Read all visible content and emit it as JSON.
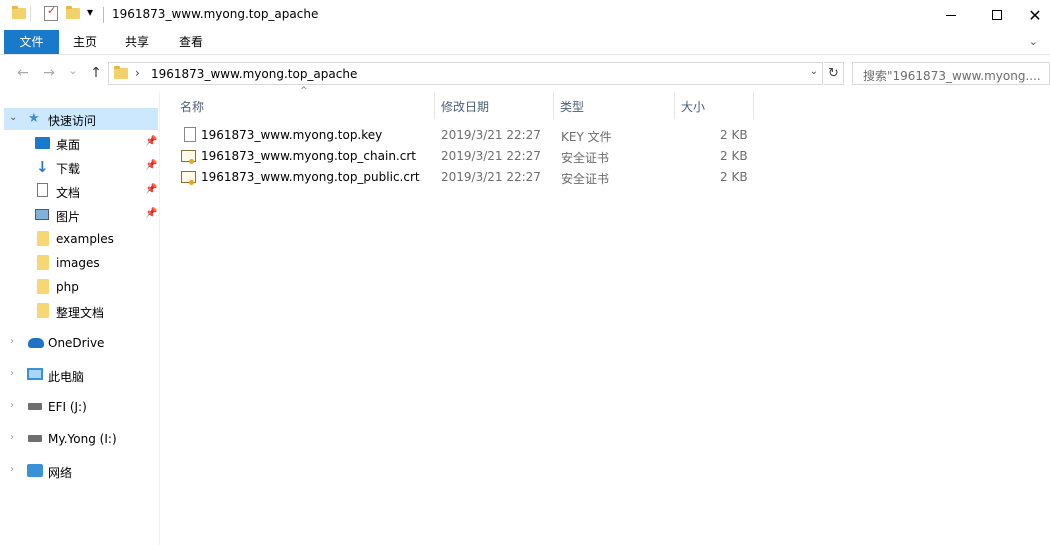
{
  "window": {
    "title": "1961873_www.myong.top_apache",
    "close_glyph": "✕"
  },
  "qat": {
    "dropdown_glyph": "▾"
  },
  "ribbon": {
    "tabs": [
      "文件",
      "主页",
      "共享",
      "查看"
    ]
  },
  "address": {
    "back_glyph": "←",
    "forward_glyph": "→",
    "recent_glyph": "⌄",
    "up_glyph": "↑",
    "chevron": "›",
    "path": "1961873_www.myong.top_apache",
    "dropdown_glyph": "⌄",
    "refresh_glyph": "↻",
    "search_placeholder": "搜索\"1961873_www.myong...."
  },
  "nav": {
    "quick_access": "快速访问",
    "pinned": [
      {
        "label": "桌面",
        "icon": "desktop-icon"
      },
      {
        "label": "下载",
        "icon": "download-icon"
      },
      {
        "label": "文档",
        "icon": "document-icon"
      },
      {
        "label": "图片",
        "icon": "pictures-icon"
      }
    ],
    "folders": [
      "examples",
      "images",
      "php",
      "整理文档"
    ],
    "roots": [
      {
        "label": "OneDrive",
        "icon": "onedrive-icon"
      },
      {
        "label": "此电脑",
        "icon": "this-pc-icon"
      },
      {
        "label": "EFI (J:)",
        "icon": "drive-icon"
      },
      {
        "label": "My.Yong (I:)",
        "icon": "drive-icon"
      },
      {
        "label": "网络",
        "icon": "network-icon"
      }
    ]
  },
  "columns": {
    "name": "名称",
    "date": "修改日期",
    "type": "类型",
    "size": "大小"
  },
  "files": [
    {
      "name": "1961873_www.myong.top.key",
      "date": "2019/3/21 22:27",
      "type": "KEY 文件",
      "size": "2 KB",
      "icon": "file-icon"
    },
    {
      "name": "1961873_www.myong.top_chain.crt",
      "date": "2019/3/21 22:27",
      "type": "安全证书",
      "size": "2 KB",
      "icon": "certificate-icon"
    },
    {
      "name": "1961873_www.myong.top_public.crt",
      "date": "2019/3/21 22:27",
      "type": "安全证书",
      "size": "2 KB",
      "icon": "certificate-icon"
    }
  ]
}
